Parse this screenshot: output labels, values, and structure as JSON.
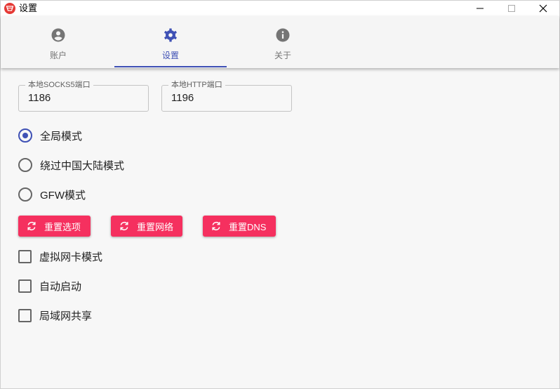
{
  "window": {
    "title": "设置",
    "accent": "#3f51b5",
    "button_color": "#f5305f"
  },
  "tabs": [
    {
      "label": "账户",
      "icon": "account-circle-icon"
    },
    {
      "label": "设置",
      "icon": "gear-icon",
      "active": true
    },
    {
      "label": "关于",
      "icon": "info-icon"
    }
  ],
  "ports": {
    "socks_label": "本地SOCKS5端口",
    "socks_value": "1186",
    "http_label": "本地HTTP端口",
    "http_value": "1196"
  },
  "modes": [
    {
      "label": "全局模式",
      "selected": true
    },
    {
      "label": "绕过中国大陆模式",
      "selected": false
    },
    {
      "label": "GFW模式",
      "selected": false
    }
  ],
  "buttons": {
    "reset_options": "重置选项",
    "reset_network": "重置网络",
    "reset_dns": "重置DNS",
    "icon": "refresh-icon"
  },
  "checkboxes": [
    {
      "label": "虚拟网卡模式",
      "checked": false
    },
    {
      "label": "自动启动",
      "checked": false
    },
    {
      "label": "局域网共享",
      "checked": false
    }
  ]
}
